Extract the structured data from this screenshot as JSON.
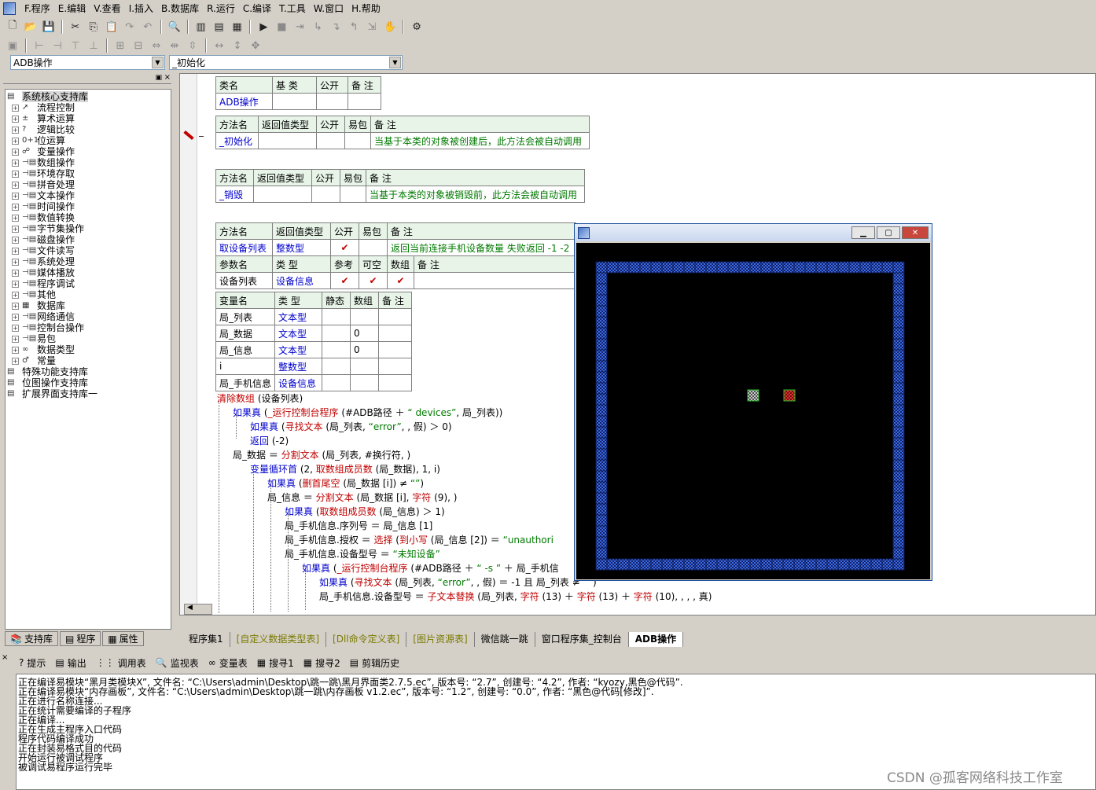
{
  "menubar": {
    "items": [
      "F.程序",
      "E.编辑",
      "V.查看",
      "I.插入",
      "B.数据库",
      "R.运行",
      "C.编译",
      "T.工具",
      "W.窗口",
      "H.帮助"
    ]
  },
  "toolbar": {
    "combo_left": "ADB操作",
    "combo_right": "_初始化"
  },
  "sidebar": {
    "tree": [
      {
        "label": "系统核心支持库",
        "icon": "book-icon",
        "top": true
      },
      {
        "label": "流程控制",
        "icon": "flow-icon"
      },
      {
        "label": "算术运算",
        "icon": "math-icon"
      },
      {
        "label": "逻辑比较",
        "icon": "logic-icon"
      },
      {
        "label": "位运算",
        "icon": "bit-icon"
      },
      {
        "label": "变量操作",
        "icon": "var-icon"
      },
      {
        "label": "数组操作",
        "icon": "cmd-icon"
      },
      {
        "label": "环境存取",
        "icon": "cmd-icon"
      },
      {
        "label": "拼音处理",
        "icon": "cmd-icon"
      },
      {
        "label": "文本操作",
        "icon": "cmd-icon"
      },
      {
        "label": "时间操作",
        "icon": "cmd-icon"
      },
      {
        "label": "数值转换",
        "icon": "cmd-icon"
      },
      {
        "label": "字节集操作",
        "icon": "cmd-icon"
      },
      {
        "label": "磁盘操作",
        "icon": "cmd-icon"
      },
      {
        "label": "文件读写",
        "icon": "cmd-icon"
      },
      {
        "label": "系统处理",
        "icon": "cmd-icon"
      },
      {
        "label": "媒体播放",
        "icon": "cmd-icon"
      },
      {
        "label": "程序调试",
        "icon": "cmd-icon"
      },
      {
        "label": "其他",
        "icon": "cmd-icon"
      },
      {
        "label": "数据库",
        "icon": "db-icon"
      },
      {
        "label": "网络通信",
        "icon": "cmd-icon"
      },
      {
        "label": "控制台操作",
        "icon": "cmd-icon"
      },
      {
        "label": "易包",
        "icon": "cmd-icon"
      },
      {
        "label": "数据类型",
        "icon": "type-icon"
      },
      {
        "label": "常量",
        "icon": "const-icon"
      },
      {
        "label": "特殊功能支持库",
        "icon": "book-icon",
        "top": true
      },
      {
        "label": "位图操作支持库",
        "icon": "book-icon",
        "top": true
      },
      {
        "label": "扩展界面支持库一",
        "icon": "book-icon",
        "top": true
      }
    ],
    "tabs": [
      "支持库",
      "程序",
      "属性"
    ]
  },
  "editor": {
    "class_table": {
      "headers": [
        "类名",
        "基 类",
        "公开",
        "备 注"
      ],
      "row": [
        "ADB操作",
        "",
        "",
        ""
      ]
    },
    "method_init": {
      "headers": [
        "方法名",
        "返回值类型",
        "公开",
        "易包",
        "备 注"
      ],
      "row": [
        "_初始化",
        "",
        "",
        "",
        "当基于本类的对象被创建后，此方法会被自动调用"
      ]
    },
    "method_destroy": {
      "headers": [
        "方法名",
        "返回值类型",
        "公开",
        "易包",
        "备 注"
      ],
      "row": [
        "_销毁",
        "",
        "",
        "",
        "当基于本类的对象被销毁前，此方法会被自动调用"
      ]
    },
    "method_list": {
      "headers": [
        "方法名",
        "返回值类型",
        "公开",
        "易包",
        "备 注"
      ],
      "row": [
        "取设备列表",
        "整数型",
        "✔",
        "",
        "返回当前连接手机设备数量 失败返回 -1 -2"
      ],
      "param_headers": [
        "参数名",
        "类 型",
        "参考",
        "可空",
        "数组",
        "备 注"
      ],
      "param_row": [
        "设备列表",
        "设备信息",
        "✔",
        "✔",
        "✔",
        ""
      ]
    },
    "var_table": {
      "headers": [
        "变量名",
        "类 型",
        "静态",
        "数组",
        "备 注"
      ],
      "rows": [
        [
          "局_列表",
          "文本型",
          "",
          "",
          ""
        ],
        [
          "局_数据",
          "文本型",
          "",
          "0",
          ""
        ],
        [
          "局_信息",
          "文本型",
          "",
          "0",
          ""
        ],
        [
          "i",
          "整数型",
          "",
          "",
          ""
        ],
        [
          "局_手机信息",
          "设备信息",
          "",
          "",
          ""
        ]
      ]
    },
    "code_lines": [
      "清除数组 (设备列表)",
      "如果真 (_运行控制台程序 (#ADB路径 ＋ “ devices”, 局_列表))",
      "如果真 (寻找文本 (局_列表, “error”, , 假) ＞ 0)",
      "返回 (-2)",
      "局_数据 ＝ 分割文本 (局_列表, #换行符, )",
      "变量循环首 (2, 取数组成员数 (局_数据), 1, i)",
      "如果真 (删首尾空 (局_数据 [i]) ≠ “”)",
      "局_信息 ＝ 分割文本 (局_数据 [i], 字符 (9), )",
      "如果真 (取数组成员数 (局_信息) ＞ 1)",
      "局_手机信息.序列号 ＝ 局_信息 [1]",
      "局_手机信息.授权 ＝ 选择 (到小写 (局_信息 [2]) ＝ “unauthori",
      "局_手机信息.设备型号 ＝ “未知设备”",
      "如果真 (_运行控制台程序 (#ADB路径 ＋ “ -s ” ＋ 局_手机信",
      "如果真 (寻找文本 (局_列表, “error”, , 假) ＝ -1 且 局_列表 ≠ “”)",
      "局_手机信息.设备型号 ＝ 子文本替换 (局_列表, 字符 (13) ＋ 字符 (13) ＋ 字符 (10), , , , 真)"
    ],
    "tabs": [
      "程序集1",
      "[自定义数据类型表]",
      "[Dll命令定义表]",
      "[图片资源表]",
      "微信跳一跳",
      "窗口程序集_控制台",
      "ADB操作"
    ]
  },
  "output": {
    "tabs": [
      "提示",
      "输出",
      "调用表",
      "监视表",
      "变量表",
      "搜寻1",
      "搜寻2",
      "剪辑历史"
    ],
    "lines": [
      "正在编译易模块“黑月类模块X”, 文件名: “C:\\Users\\admin\\Desktop\\跳一跳\\黑月界面类2.7.5.ec”, 版本号: “2.7”, 创建号: “4.2”, 作者: “kyozy,黑色@代码”.",
      "正在编译易模块“内存画板”, 文件名: “C:\\Users\\admin\\Desktop\\跳一跳\\内存画板 v1.2.ec”, 版本号: “1.2”, 创建号: “0.0”, 作者: “黑色@代码[修改]”.",
      "正在进行名称连接...",
      "正在统计需要编译的子程序",
      "正在编译...",
      "正在生成主程序入口代码",
      "程序代码编译成功",
      "正在封装易格式目的代码",
      "开始运行被调试程序",
      "被调试易程序运行完毕"
    ]
  },
  "watermark": "CSDN @孤客网络科技工作室",
  "colors": {
    "game_bg": "#000000",
    "game_border": "#1e4fc0",
    "piece_gray": "#a0a0a0",
    "piece_red": "#d02020",
    "comment_green": "#007a00"
  }
}
